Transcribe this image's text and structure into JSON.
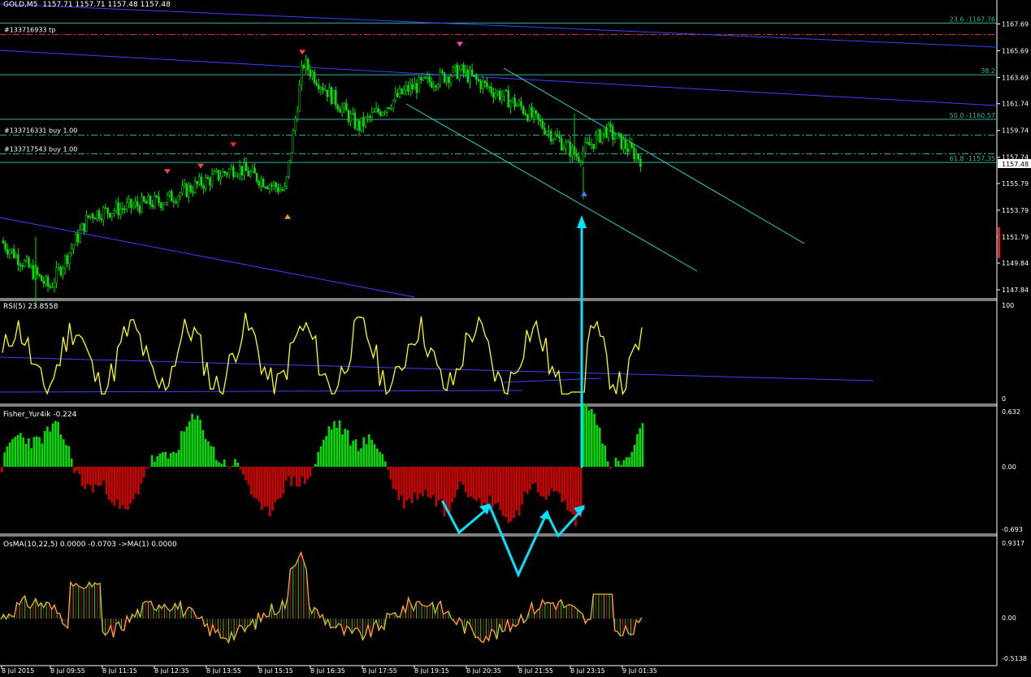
{
  "window": {
    "title": "GOLD,M5",
    "ohlc": "1157.71 1157.71 1157.48 1157.48"
  },
  "colors": {
    "background": "#000000",
    "bull": "#00e000",
    "bear": "#d00000",
    "rsi": "#ffff00",
    "trend": "#4040ff",
    "channel": "#30d0c0",
    "arrow": "#00e5ff",
    "fib": "#30b0a0",
    "tp": "#ff3030",
    "order": "#30b0a0",
    "osma_line": "#f0b030"
  },
  "price_panel": {
    "y_ticks": [
      "1167.69",
      "1165.69",
      "1163.69",
      "1161.74",
      "1159.74",
      "1157.74",
      "1155.79",
      "1153.79",
      "1151.79",
      "1149.84",
      "1147.84"
    ],
    "last_price": "1157.48",
    "ylim": [
      1147.3,
      1169.3
    ],
    "orders": [
      {
        "label": "#133716933 tp",
        "price": 1166.9
      },
      {
        "label": "#133716331 buy 1.00",
        "price": 1159.4
      },
      {
        "label": "#133717543 buy 1.00",
        "price": 1158.0
      }
    ],
    "fib_levels": [
      {
        "label": "23.6 -1167.76",
        "price": 1167.76
      },
      {
        "label": "38.2",
        "price": 1163.9
      },
      {
        "label": "50.0 -1160.57",
        "price": 1160.57
      },
      {
        "label": "61.8 -1157.35",
        "price": 1157.35
      }
    ]
  },
  "rsi_panel": {
    "label": "RSI(5) 23.8558",
    "ticks": [
      "100",
      "0"
    ]
  },
  "fisher_panel": {
    "label": "Fisher_Yur4ik -0.224",
    "ticks": [
      "0.632",
      "0.00",
      "-0.693"
    ]
  },
  "osma_panel": {
    "label": "OsMA(10,22,5) 0.0000 -0.0703 ->MA(1) 0.0000",
    "ticks": [
      "0.9317",
      "0.00",
      "-0.5138"
    ]
  },
  "time_axis": [
    "8 Jul 2015",
    "8 Jul 09:55",
    "8 Jul 11:15",
    "8 Jul 12:35",
    "8 Jul 13:55",
    "8 Jul 15:15",
    "8 Jul 16:35",
    "8 Jul 17:55",
    "8 Jul 19:15",
    "8 Jul 20:35",
    "8 Jul 21:55",
    "8 Jul 23:15",
    "9 Jul 01:35"
  ],
  "chart_data": {
    "type": "candlestick",
    "symbol": "GOLD",
    "timeframe": "M5",
    "x": [
      "8 Jul 2015",
      "8 Jul 09:55",
      "8 Jul 11:15",
      "8 Jul 12:35",
      "8 Jul 13:55",
      "8 Jul 15:15",
      "8 Jul 16:35",
      "8 Jul 17:55",
      "8 Jul 19:15",
      "8 Jul 20:35",
      "8 Jul 21:55",
      "8 Jul 23:15",
      "9 Jul 01:35"
    ],
    "close": [
      1150.0,
      1149.2,
      1153.0,
      1154.0,
      1157.2,
      1155.0,
      1163.3,
      1160.8,
      1162.6,
      1163.6,
      1163.0,
      1158.2,
      1157.48
    ],
    "rsi": [
      30,
      60,
      85,
      55,
      70,
      62,
      90,
      68,
      80,
      60,
      42,
      88,
      24
    ],
    "fisher": [
      -0.35,
      0.45,
      -0.15,
      0.4,
      -0.2,
      0.4,
      -0.25,
      0.15,
      -0.3,
      -0.45,
      -0.6,
      0.6,
      -0.224
    ],
    "osma": [
      0.0,
      0.4,
      -0.05,
      0.1,
      0.0,
      0.9,
      -0.3,
      0.05,
      0.1,
      -0.1,
      -0.05,
      0.3,
      0.0
    ]
  }
}
